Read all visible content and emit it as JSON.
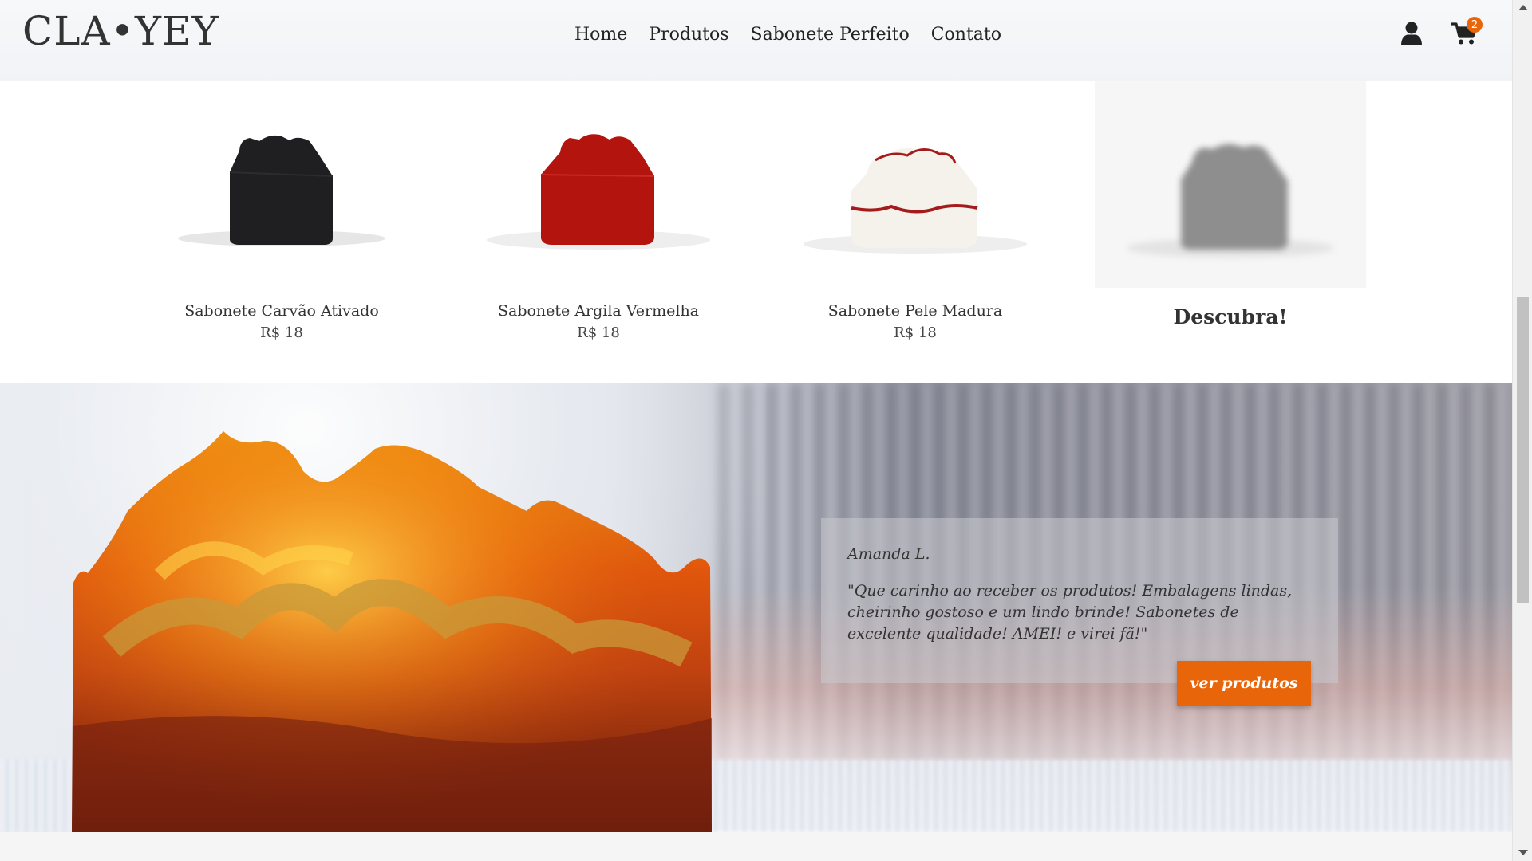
{
  "header": {
    "logo": "CLA•YEY",
    "nav": [
      "Home",
      "Produtos",
      "Sabonete Perfeito",
      "Contato"
    ],
    "user_icon": "user-icon",
    "cart_icon": "cart-icon",
    "cart_count": "2"
  },
  "products": [
    {
      "name": "Sabonete Carvão Ativado",
      "price": "R$ 18",
      "color": "#1c1c1e"
    },
    {
      "name": "Sabonete Argila Vermelha",
      "price": "R$ 18",
      "color": "#b5160f"
    },
    {
      "name": "Sabonete Pele Madura",
      "price": "R$ 18",
      "color": "#f4f0ea"
    },
    {
      "discover": "Descubra!",
      "color": "#8e8e8e"
    }
  ],
  "testimonial": {
    "author": "Amanda L.",
    "quote": "\"Que carinho ao receber os produtos! Embalagens lindas, cheirinho gostoso e um lindo brinde! Sabonetes de excelente qualidade! AMEI! e virei fã!\"",
    "cta": "ver produtos"
  },
  "colors": {
    "accent": "#e8650a"
  }
}
